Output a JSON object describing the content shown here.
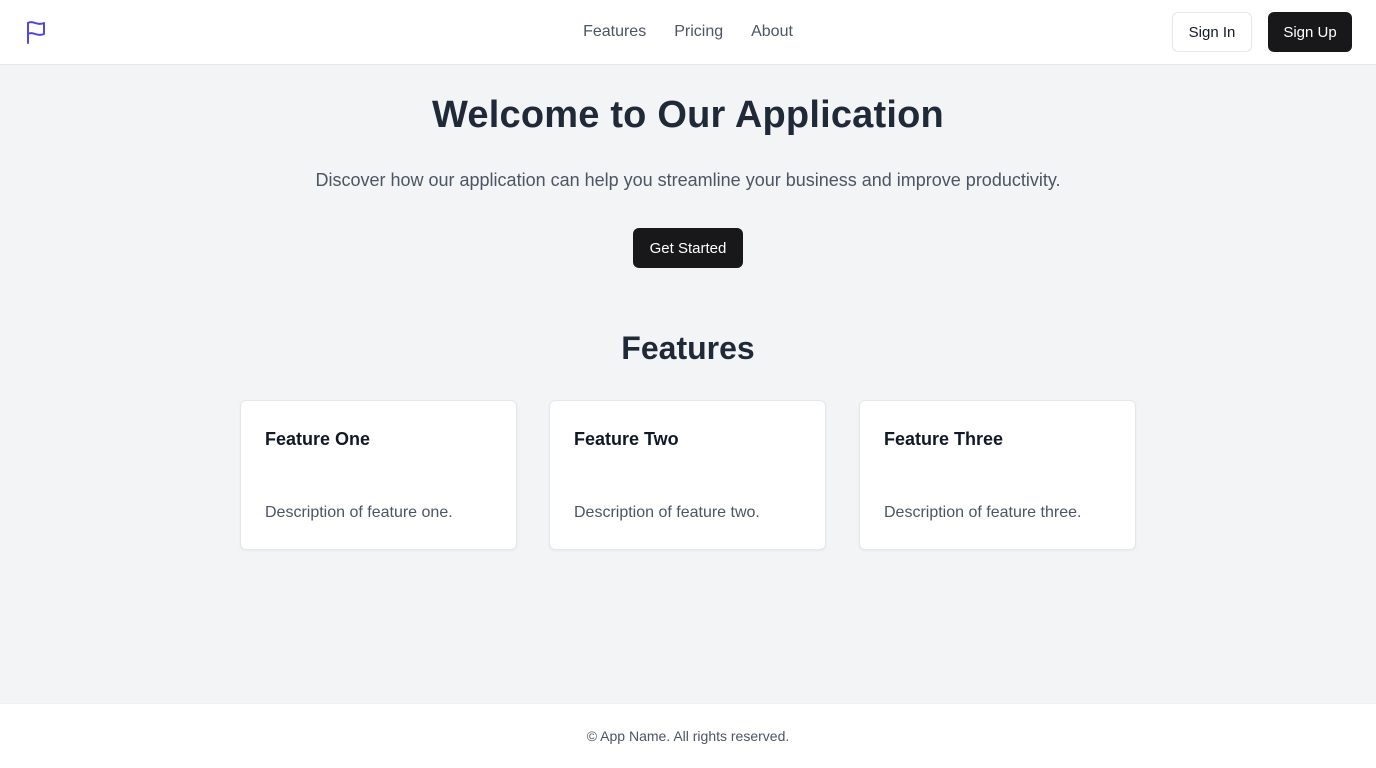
{
  "header": {
    "logo_icon": "flag-icon",
    "nav": [
      {
        "label": "Features"
      },
      {
        "label": "Pricing"
      },
      {
        "label": "About"
      }
    ],
    "sign_in_label": "Sign In",
    "sign_up_label": "Sign Up"
  },
  "hero": {
    "title": "Welcome to Our Application",
    "subtitle": "Discover how our application can help you streamline your business and improve productivity.",
    "cta_label": "Get Started"
  },
  "features": {
    "title": "Features",
    "cards": [
      {
        "title": "Feature One",
        "description": "Description of feature one."
      },
      {
        "title": "Feature Two",
        "description": "Description of feature two."
      },
      {
        "title": "Feature Three",
        "description": "Description of feature three."
      }
    ]
  },
  "footer": {
    "text": "© App Name. All rights reserved."
  },
  "colors": {
    "accent": "#4f46e5",
    "primary_button": "#18181b",
    "page_background": "#f3f4f6"
  }
}
